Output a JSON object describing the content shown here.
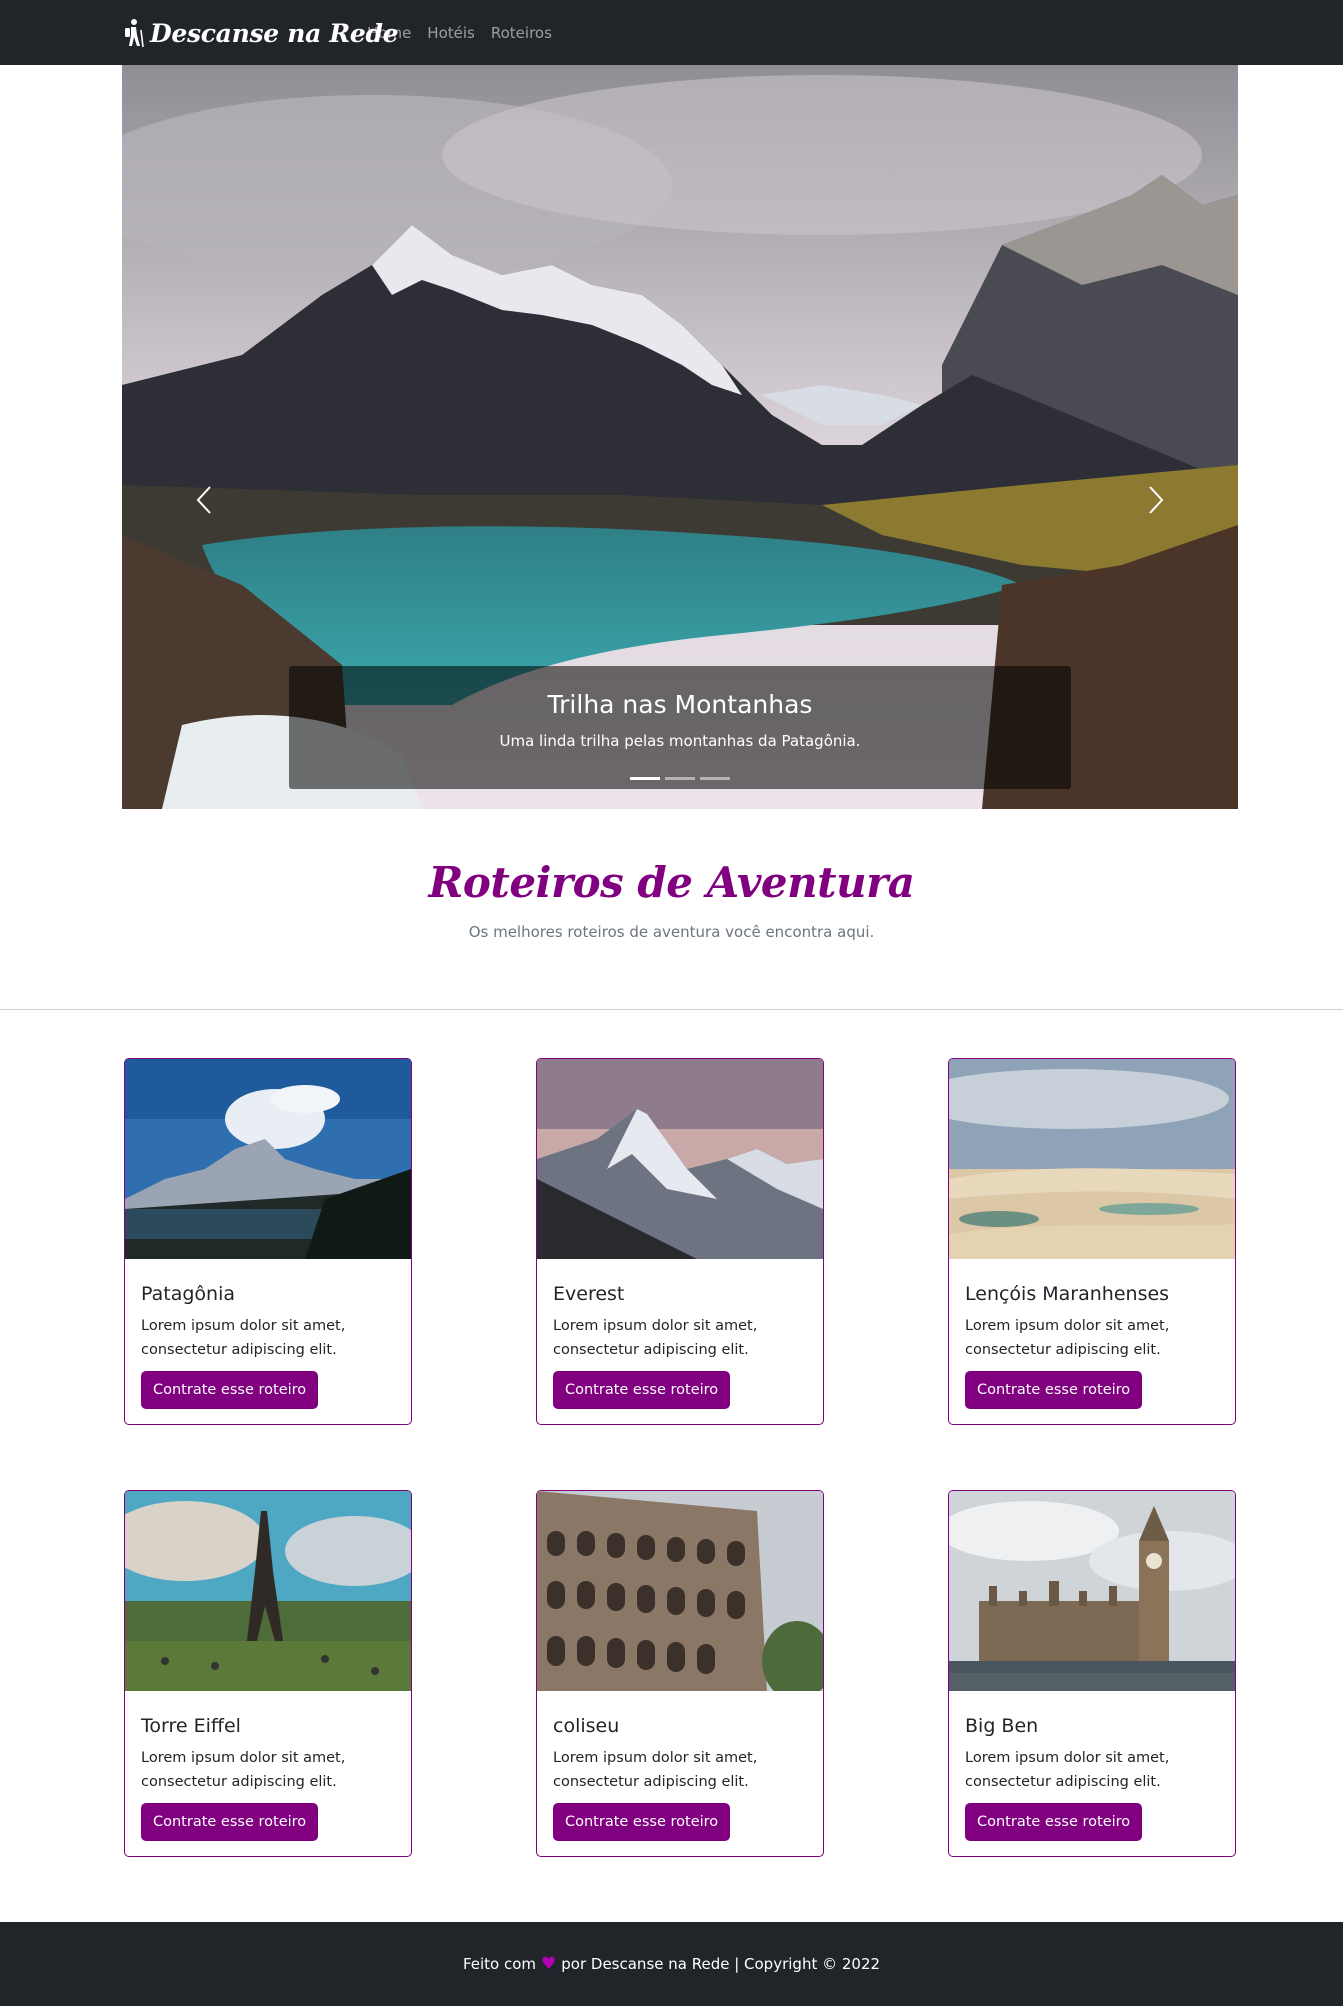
{
  "navbar": {
    "brand": "Descanse na Rede",
    "brand_icon": "hiker-icon",
    "links": [
      {
        "label": "Home"
      },
      {
        "label": "Hotéis"
      },
      {
        "label": "Roteiros"
      }
    ]
  },
  "carousel": {
    "caption_title": "Trilha nas Montanhas",
    "caption_text": "Uma linda trilha pelas montanhas da Patagônia.",
    "slide_count": 3,
    "active_slide": 1,
    "prev_icon": "chevron-left-icon",
    "next_icon": "chevron-right-icon"
  },
  "section": {
    "title": "Roteiros de Aventura",
    "subtitle": "Os melhores roteiros de aventura você encontra aqui."
  },
  "cards": [
    {
      "title": "Patagônia",
      "text": "Lorem ipsum dolor sit amet, consectetur adipiscing elit.",
      "button": "Contrate esse roteiro"
    },
    {
      "title": "Everest",
      "text": "Lorem ipsum dolor sit amet, consectetur adipiscing elit.",
      "button": "Contrate esse roteiro"
    },
    {
      "title": "Lençóis Maranhenses",
      "text": "Lorem ipsum dolor sit amet, consectetur adipiscing elit.",
      "button": "Contrate esse roteiro"
    },
    {
      "title": "Torre Eiffel",
      "text": "Lorem ipsum dolor sit amet, consectetur adipiscing elit.",
      "button": "Contrate esse roteiro"
    },
    {
      "title": "coliseu",
      "text": "Lorem ipsum dolor sit amet, consectetur adipiscing elit.",
      "button": "Contrate esse roteiro"
    },
    {
      "title": "Big Ben",
      "text": "Lorem ipsum dolor sit amet, consectetur adipiscing elit.",
      "button": "Contrate esse roteiro"
    }
  ],
  "footer": {
    "prefix": "Feito com",
    "heart": "♥",
    "suffix": "por Descanse na Rede | Copyright © 2022"
  },
  "colors": {
    "brand_purple": "#800080",
    "navbar_bg": "#212529"
  }
}
